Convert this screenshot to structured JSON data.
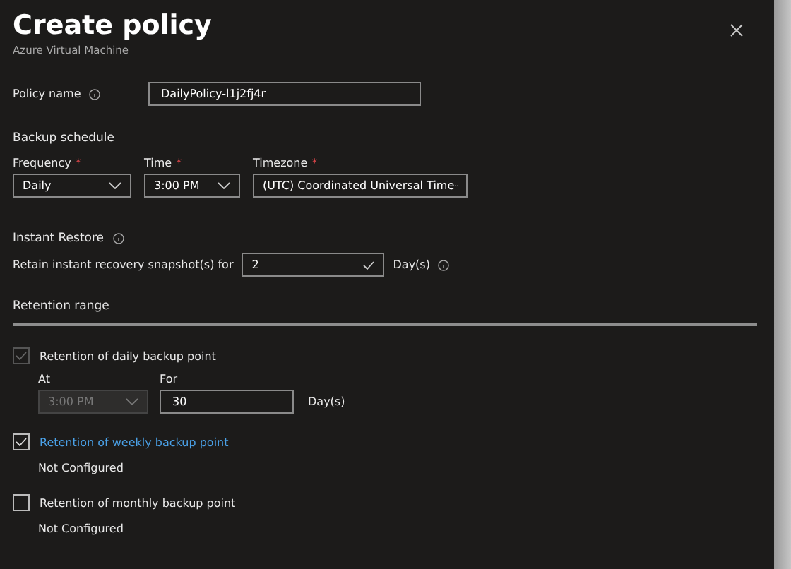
{
  "title": "Create policy",
  "subtitle": "Azure Virtual Machine",
  "policy_name": {
    "label": "Policy name",
    "value": "DailyPolicy-l1j2fj4r"
  },
  "backup_schedule": {
    "heading": "Backup schedule",
    "fields": [
      {
        "label": "Frequency",
        "required": true,
        "required_marker": "*",
        "value": "Daily"
      },
      {
        "label": "Time",
        "required": true,
        "required_marker": "*",
        "value": "3:00 PM"
      },
      {
        "label": "Timezone",
        "required": true,
        "required_marker": "*",
        "value": "(UTC) Coordinated Universal Time"
      }
    ]
  },
  "instant_restore": {
    "heading": "Instant Restore",
    "label": "Retain instant recovery snapshot(s) for",
    "value": "2",
    "unit": "Day(s)"
  },
  "retention_range": {
    "heading": "Retention range",
    "items": [
      {
        "kind": "schedule",
        "label": "Retention of daily backup point",
        "checked": true,
        "disabled": true,
        "at_label": "At",
        "at_value": "3:00 PM",
        "for_label": "For",
        "for_value": "30",
        "unit": "Day(s)"
      },
      {
        "kind": "status",
        "label": "Retention of weekly backup point",
        "checked": true,
        "disabled": false,
        "status": "Not Configured"
      },
      {
        "kind": "status",
        "label": "Retention of monthly backup point",
        "checked": false,
        "disabled": false,
        "status": "Not Configured"
      }
    ]
  }
}
